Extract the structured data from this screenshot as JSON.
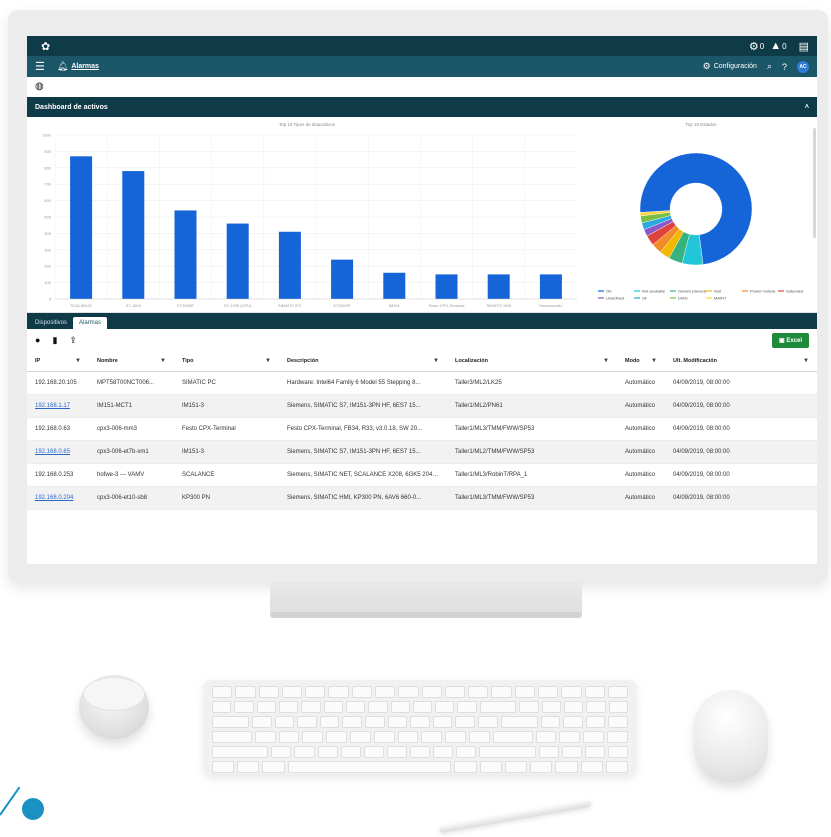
{
  "topbar": {
    "logo_icon": "flower-logo-icon",
    "right_icons": [
      "settings-icon",
      "warning-icon",
      "user-icon"
    ],
    "status_counts": [
      "0",
      "0"
    ]
  },
  "navbar": {
    "alarms_label": "Alarmas",
    "config_label": "Configuración",
    "avatar_initials": "AC"
  },
  "dashboard": {
    "title": "Dashboard de activos"
  },
  "chart_data": [
    {
      "type": "bar",
      "title": "Top 10 Tipos de dispositivos",
      "categories": [
        "SCALANCE",
        "S7-1500",
        "ET200SP",
        "S7-1200 (CPU)",
        "SIMATIC IPC",
        "ET200SP",
        "IM151",
        "Festo CPX-Terminal",
        "SIMATIC HMI",
        "Desconocido"
      ],
      "values": [
        870,
        780,
        540,
        460,
        410,
        240,
        160,
        150,
        150,
        150
      ],
      "ylim": [
        0,
        1000
      ],
      "yticks": [
        "0",
        "100",
        "200",
        "300",
        "400",
        "500",
        "600",
        "700",
        "800",
        "900",
        "1000"
      ],
      "color": "#1565d8"
    },
    {
      "type": "pie",
      "title": "Top 10 Estados",
      "labels": [
        "OK",
        "Not available",
        "Guided (Saved)",
        "Null",
        "Power module",
        "Saturated",
        "Undefined",
        "SF",
        "DIAG",
        "MAINT"
      ],
      "values": [
        74,
        6,
        4,
        3,
        3,
        3,
        2,
        2,
        2,
        1
      ],
      "colors": [
        "#1565d8",
        "#21c6d8",
        "#36b37e",
        "#f5b800",
        "#f28c28",
        "#e0433c",
        "#8a58c7",
        "#2aa8e0",
        "#7bc043",
        "#ffd13b"
      ]
    }
  ],
  "tabs": [
    "Dispositivos",
    "Alarmas"
  ],
  "toolbar": {
    "excel_label": "Excel"
  },
  "table": {
    "columns": [
      "IP",
      "Nombre",
      "Tipo",
      "Descripción",
      "Localización",
      "Modo",
      "Ult. Modificación"
    ],
    "rows": [
      [
        "192.168.20.105",
        "MPT58T00NCT006...",
        "SIMATIC PC",
        "Hardware: Intel64 Family 6 Model 55 Stepping 8...",
        "Taller3/ML2/LK25",
        "Automático",
        "04/09/2019, 08:00:00"
      ],
      [
        "192.168.1.17",
        "IM151-MCT1",
        "IM151-3",
        "Siemens, SIMATIC S7, IM151-3PN HF, 6ES7 15...",
        "Taller1/ML2/PN61",
        "Automático",
        "04/09/2019, 08:00:00"
      ],
      [
        "192.168.0.63",
        "cpx3-006-mm3",
        "Festo CPX-Terminal",
        "Festo CPX-Terminal, FB34, R33, v3.0.18, SW 20...",
        "Taller1/ML3/TMM/FWW/SP53",
        "Automático",
        "04/09/2019, 08:00:00"
      ],
      [
        "192.168.0.65",
        "cpx3-006-et7b-xm1",
        "IM151-3",
        "Siemens, SIMATIC S7, IM151-3PN HF, 6ES7 15...",
        "Taller1/ML2/TMM/FWW/SP53",
        "Automático",
        "04/09/2019, 08:00:00"
      ],
      [
        "192.168.0.253",
        "hofwe-3 --- VAMV",
        "SCALANCE",
        "Siemens, SIMATIC NET, SCALANCE X208, 6GK5 204-0...",
        "Taller1/ML3/RobinT/RPA_1",
        "Automático",
        "04/09/2019, 08:00:00"
      ],
      [
        "192.168.0.204",
        "cpx3-006-et10-sb8",
        "KP300 PN",
        "Siemens, SIMATIC HMI, KP300 PN, 6AV6 660-0...",
        "Taller1/ML3/TMM/FWW/SP53",
        "Automático",
        "04/09/2019, 08:00:00"
      ]
    ]
  }
}
